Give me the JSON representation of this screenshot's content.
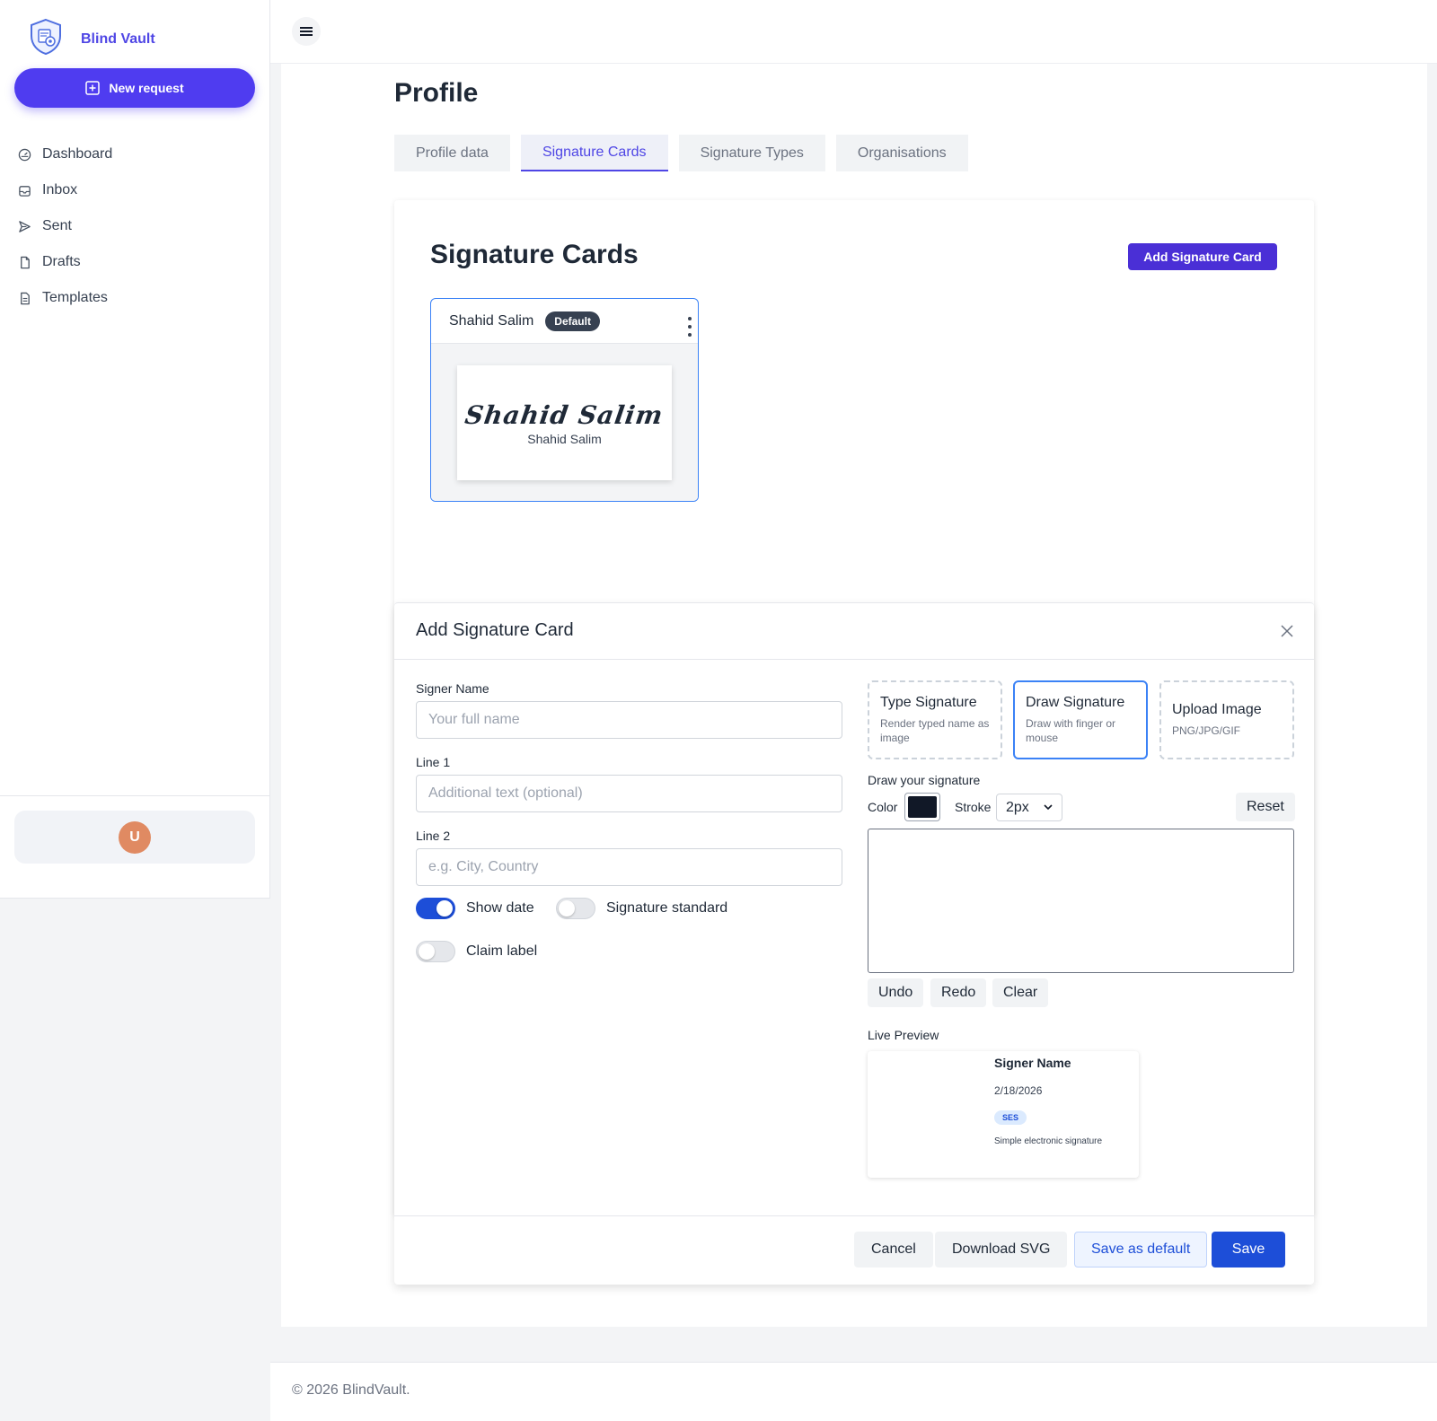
{
  "app": {
    "name": "Blind Vault",
    "new_request_label": "New request"
  },
  "sidebar": {
    "items": [
      {
        "label": "Dashboard",
        "icon": "gauge-icon"
      },
      {
        "label": "Inbox",
        "icon": "inbox-icon"
      },
      {
        "label": "Sent",
        "icon": "send-icon"
      },
      {
        "label": "Drafts",
        "icon": "file-icon"
      },
      {
        "label": "Templates",
        "icon": "file-text-icon"
      }
    ],
    "user_initial": "U"
  },
  "page": {
    "title": "Profile",
    "tabs": [
      {
        "label": "Profile data",
        "active": false
      },
      {
        "label": "Signature Cards",
        "active": true
      },
      {
        "label": "Signature Types",
        "active": false
      },
      {
        "label": "Organisations",
        "active": false
      }
    ]
  },
  "signature_cards": {
    "title": "Signature Cards",
    "add_button": "Add Signature Card",
    "cards": [
      {
        "name": "Shahid Salim",
        "badge": "Default",
        "script": "Shahid Salim",
        "subtitle": "Shahid Salim"
      }
    ]
  },
  "modal": {
    "title": "Add Signature Card",
    "signer_name_label": "Signer Name",
    "signer_name_placeholder": "Your full name",
    "line1_label": "Line 1",
    "line1_placeholder": "Additional text (optional)",
    "line2_label": "Line 2",
    "line2_placeholder": "e.g. City, Country",
    "toggles": {
      "show_date": {
        "label": "Show date",
        "on": true
      },
      "signature_standard": {
        "label": "Signature standard",
        "on": false
      },
      "claim_label": {
        "label": "Claim label",
        "on": false
      }
    },
    "modes": [
      {
        "title": "Type Signature",
        "desc": "Render typed name as image",
        "active": false
      },
      {
        "title": "Draw Signature",
        "desc": "Draw with finger or mouse",
        "active": true
      },
      {
        "title": "Upload Image",
        "desc": "PNG/JPG/GIF",
        "active": false
      }
    ],
    "draw_label": "Draw your signature",
    "color_label": "Color",
    "color_value": "#111827",
    "stroke_label": "Stroke",
    "stroke_value": "2px",
    "reset_label": "Reset",
    "undo_label": "Undo",
    "redo_label": "Redo",
    "clear_label": "Clear",
    "live_preview_label": "Live Preview",
    "preview": {
      "name": "Signer Name",
      "date": "2/18/2026",
      "badge": "SES",
      "standard": "Simple electronic signature"
    },
    "footer": {
      "cancel": "Cancel",
      "download": "Download SVG",
      "save_default": "Save as default",
      "save": "Save"
    }
  },
  "footer": {
    "copyright": "© 2026 BlindVault."
  },
  "colors": {
    "accent": "#4f46e5",
    "primary_button": "#1d4ed8",
    "avatar": "#e08a62"
  }
}
